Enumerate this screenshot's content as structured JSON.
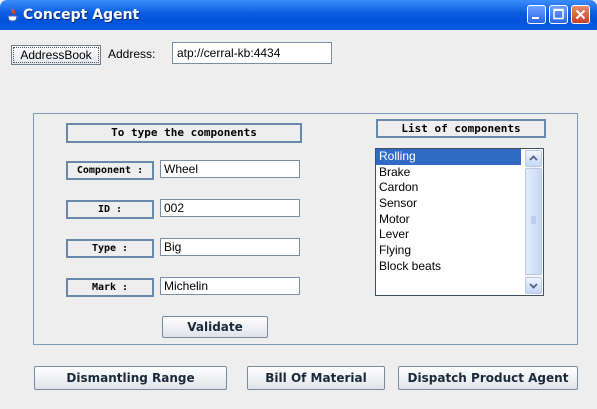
{
  "window": {
    "title": "Concept Agent",
    "colors": {
      "titlebar": "#0a5be0",
      "selection": "#316ac5",
      "border": "#6889aa"
    }
  },
  "toolbar": {
    "addressbook_label": "AddressBook",
    "address_label": "Address:",
    "address_value": "atp://cerral-kb:4434"
  },
  "form": {
    "heading": "To type the components",
    "fields": [
      {
        "label": "Component :",
        "value": "Wheel"
      },
      {
        "label": "ID :",
        "value": "002"
      },
      {
        "label": "Type :",
        "value": "Big"
      },
      {
        "label": "Mark :",
        "value": "Michelin"
      }
    ],
    "validate_label": "Validate"
  },
  "components": {
    "heading": "List of components",
    "items": [
      "Rolling",
      "Brake",
      "Cardon",
      "Sensor",
      "Motor",
      "Lever",
      "Flying",
      "Block beats"
    ],
    "selected_index": 0
  },
  "actions": {
    "dismantling_label": "Dismantling Range",
    "bill_label": "Bill Of Material",
    "dispatch_label": "Dispatch Product Agent"
  }
}
